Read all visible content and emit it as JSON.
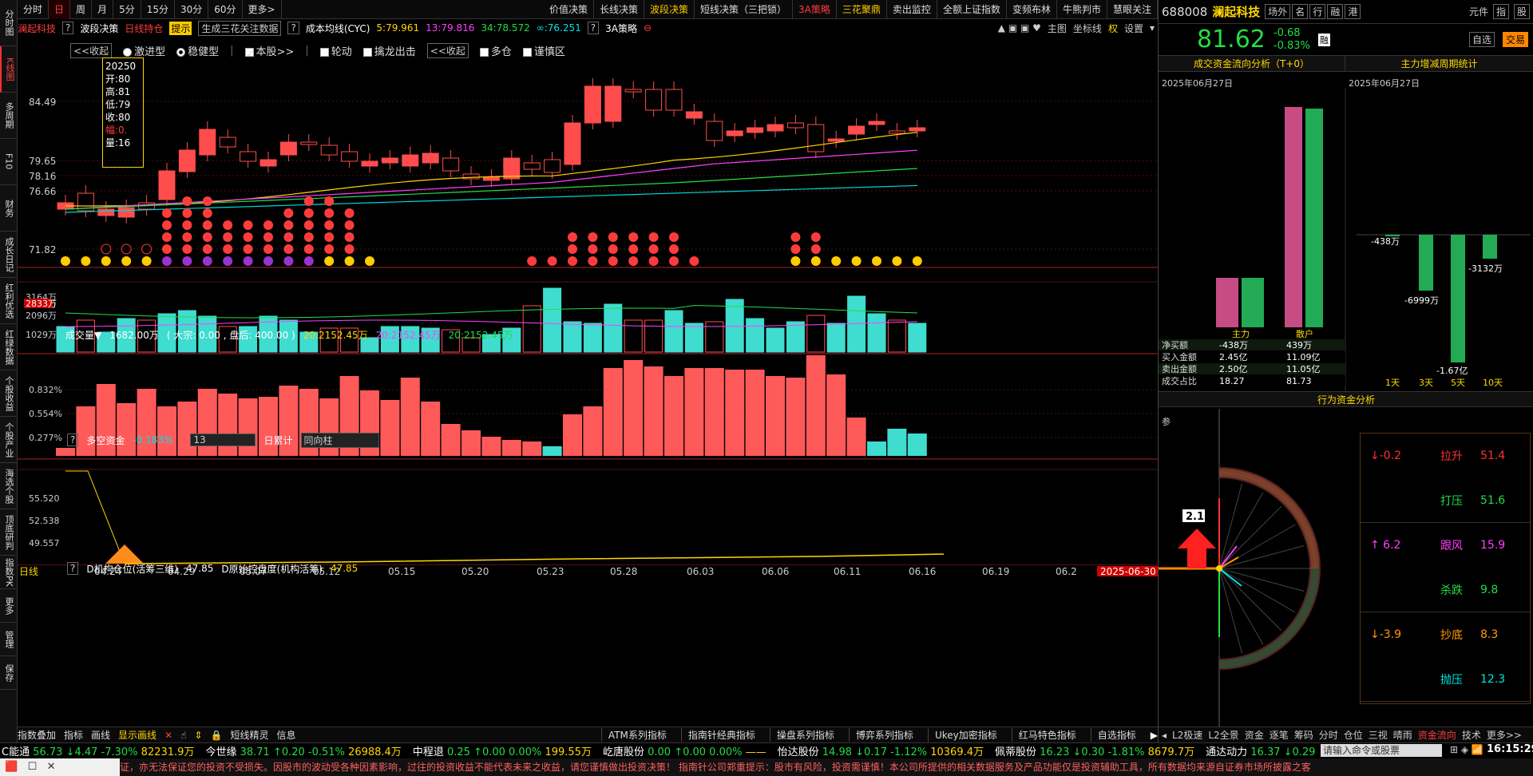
{
  "left_tabs": [
    "分时图",
    "K线图",
    "多周期",
    "F10",
    "财务",
    "成长日记",
    "红利优选",
    "红绿数据",
    "个股收益",
    "个股产业",
    "海选个股",
    "顶底研判",
    "指数PK",
    "更多",
    "管理",
    "保存"
  ],
  "left_active": 1,
  "top_tabs": [
    "分时",
    "日",
    "周",
    "月",
    "5分",
    "15分",
    "30分",
    "60分",
    "更多>"
  ],
  "top_active": 1,
  "strategy_tabs": [
    {
      "label": "价值决策",
      "c": ""
    },
    {
      "label": "长线决策",
      "c": ""
    },
    {
      "label": "波段决策",
      "c": "yellow"
    },
    {
      "label": "短线决策（三把锁）",
      "c": ""
    },
    {
      "label": "3A策略",
      "c": "red"
    },
    {
      "label": "三花聚鼎",
      "c": "yellow"
    },
    {
      "label": "卖出监控",
      "c": ""
    },
    {
      "label": "全额上证指数",
      "c": ""
    },
    {
      "label": "变频布林",
      "c": ""
    },
    {
      "label": "牛熊判市",
      "c": ""
    },
    {
      "label": "慧眼关注",
      "c": ""
    }
  ],
  "sub": {
    "stock": "澜起科技",
    "help": "?",
    "strategy": "波段决策",
    "daily": "日线持仓",
    "tip": "提示",
    "gen": "生成三花关注数据",
    "q": "?",
    "ma_title": "成本均线(CYC)",
    "ma5": "5:79.961",
    "ma13": "13:79.816",
    "ma34": "34:78.572",
    "mainf": "∞:76.251",
    "sa": "3A策略",
    "right_items": [
      "主图",
      "坐标线",
      "权",
      "设置"
    ]
  },
  "ctrl": {
    "collapse": "<<收起",
    "aggr": "激进型",
    "steady": "稳健型",
    "this": "本股>>",
    "rotate": "轮动",
    "catch": "擒龙出击",
    "collapse2": "<<收起",
    "multi": "多仓",
    "careful": "谨慎区"
  },
  "tooltip": {
    "date": "20250",
    "open": "开:80",
    "high": "高:81",
    "low": "低:79",
    "close": "收:80",
    "amp": "幅:0.",
    "vol": "量:16"
  },
  "price_ylabels": [
    "84.49",
    "79.65",
    "78.16",
    "76.66",
    "71.82"
  ],
  "vol_bar": {
    "title": "成交量▼",
    "val": "1682.00万",
    "dz": "( 大宗: 0.00 , 盘后: 400.00 )",
    "ma1": "20:2152.45万",
    "ma2": "20:2152.45万",
    "ma3": "20:2152.45万"
  },
  "vol_ylabels": [
    "3164万",
    "2833万",
    "2096万",
    "1029万"
  ],
  "dk_bar": {
    "q": "?",
    "title": "多空资金",
    "val": "-0.183%",
    "sel": "13",
    "sum": "日累计",
    "type": "同向柱"
  },
  "dk_ylabels": [
    "0.832%",
    "0.554%",
    "0.277%"
  ],
  "jg_bar": {
    "q": "?",
    "t1": "D机构仓位(活筹三维)",
    "v1": "47.85",
    "t2": "D原始控盘度(机构活筹)",
    "v2": "47.85"
  },
  "jg_ylabels": [
    "55.520",
    "52.538",
    "49.557"
  ],
  "dates": [
    "04.24",
    "04.29",
    "05.07",
    "05.12",
    "05.15",
    "05.20",
    "05.23",
    "05.28",
    "06.03",
    "06.06",
    "06.11",
    "06.16",
    "06.19",
    "06.2"
  ],
  "date_badge": "2025-06-30",
  "dayline": "日线",
  "bottom_tools": [
    "指数叠加",
    "指标",
    "画线",
    "显示画线"
  ],
  "indicator_tabs": [
    "短线精灵",
    "信息"
  ],
  "ind_series": [
    "ATM系列指标",
    "指南针经典指标",
    "操盘系列指标",
    "博弈系列指标",
    "Ukey加密指标",
    "红马特色指标",
    "自选指标"
  ],
  "right": {
    "code": "688008",
    "name": "澜起科技",
    "tabs": [
      "场外",
      "名",
      "行",
      "融",
      "港"
    ],
    "unit": "元件",
    "ctl": [
      "指",
      "股"
    ],
    "price": "81.62",
    "chg": "-0.68",
    "pct": "-0.83%",
    "auto": "自选",
    "trade": "交易",
    "flow_title": "成交资金流向分析（T+0）",
    "cycle_title": "主力增减周期统计",
    "date1": "2025年06月27日",
    "date2": "2025年06月27日",
    "bar_labels": [
      "主力",
      "散户"
    ],
    "table": [
      [
        "净买额",
        "-438万",
        "439万"
      ],
      [
        "买入金额",
        "2.45亿",
        "11.09亿"
      ],
      [
        "卖出金额",
        "2.50亿",
        "11.05亿"
      ],
      [
        "成交占比",
        "18.27",
        "81.73"
      ]
    ],
    "cycle_vals": [
      "-438万",
      "-6999万",
      "-1.67亿",
      "-3132万"
    ],
    "cycle_labels": [
      "1天",
      "3天",
      "5天",
      "10天"
    ],
    "behavior_title": "行为资金分析",
    "can": "参",
    "radar_val": "2.1",
    "behav": [
      {
        "a": "↓-0.2",
        "n": "拉升",
        "v": "51.4"
      },
      {
        "a": "",
        "n": "打压",
        "v": "51.6"
      },
      {
        "a": "↑ 6.2",
        "n": "跟风",
        "v": "15.9"
      },
      {
        "a": "",
        "n": "杀跌",
        "v": "9.8"
      },
      {
        "a": "↓-3.9",
        "n": "抄底",
        "v": "8.3"
      },
      {
        "a": "",
        "n": "抛压",
        "v": "12.3"
      }
    ],
    "bottom_tabs": [
      "L2极速",
      "L2全景",
      "资金",
      "逐笔",
      "筹码",
      "分时",
      "仓位",
      "三视",
      "晴雨",
      "资金流向",
      "技术",
      "更多>>"
    ]
  },
  "status": [
    {
      "n": "C能通",
      "v": "56.73 ↓4.47 -7.30%",
      "a": "82231.9万"
    },
    {
      "n": "今世缘",
      "v": "38.71 ↑0.20 -0.51%",
      "a": "26988.4万"
    },
    {
      "n": "中程退",
      "v": "0.25 ↑0.00 0.00%",
      "a": "199.55万"
    },
    {
      "n": "屹唐股份",
      "v": "0.00 ↑0.00 0.00%",
      "a": "——"
    },
    {
      "n": "怡达股份",
      "v": "14.98 ↓0.17 -1.12%",
      "a": "10369.4万"
    },
    {
      "n": "佩蒂股份",
      "v": "16.23 ↓0.30 -1.81%",
      "a": "8679.7万"
    },
    {
      "n": "通达动力",
      "v": "16.37 ↓0.29",
      "a": ""
    }
  ],
  "cmd": "请输入命令或股票",
  "time": "16:15:29",
  "ticker": "完整性和及时性做出任何保证，亦无法保证您的投资不受损失。因股市的波动受各种因素影响，过往的投资收益不能代表未来之收益，请您谨慎做出投资决策！        指南针公司郑重提示：股市有风险，投资需谨慎！本公司所提供的相关数据服务及产品功能仅是投资辅助工具，所有数据均来源自证券市场所披露之客"
}
